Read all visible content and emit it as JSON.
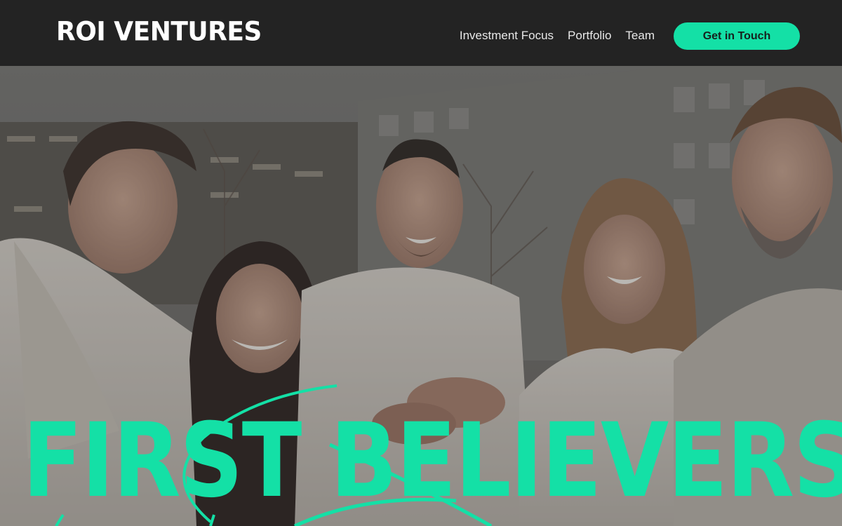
{
  "header": {
    "logo": "ROI VENTURES",
    "nav": [
      {
        "label": "Investment Focus"
      },
      {
        "label": "Portfolio"
      },
      {
        "label": "Team"
      }
    ],
    "cta_label": "Get in Touch"
  },
  "hero": {
    "headline": "FIRST BELIEVERS.",
    "image_alt": "Team photo of five smiling people joining hands outdoors"
  },
  "colors": {
    "accent": "#14e0a6",
    "header_bg": "#232323",
    "text_light": "#ffffff"
  }
}
